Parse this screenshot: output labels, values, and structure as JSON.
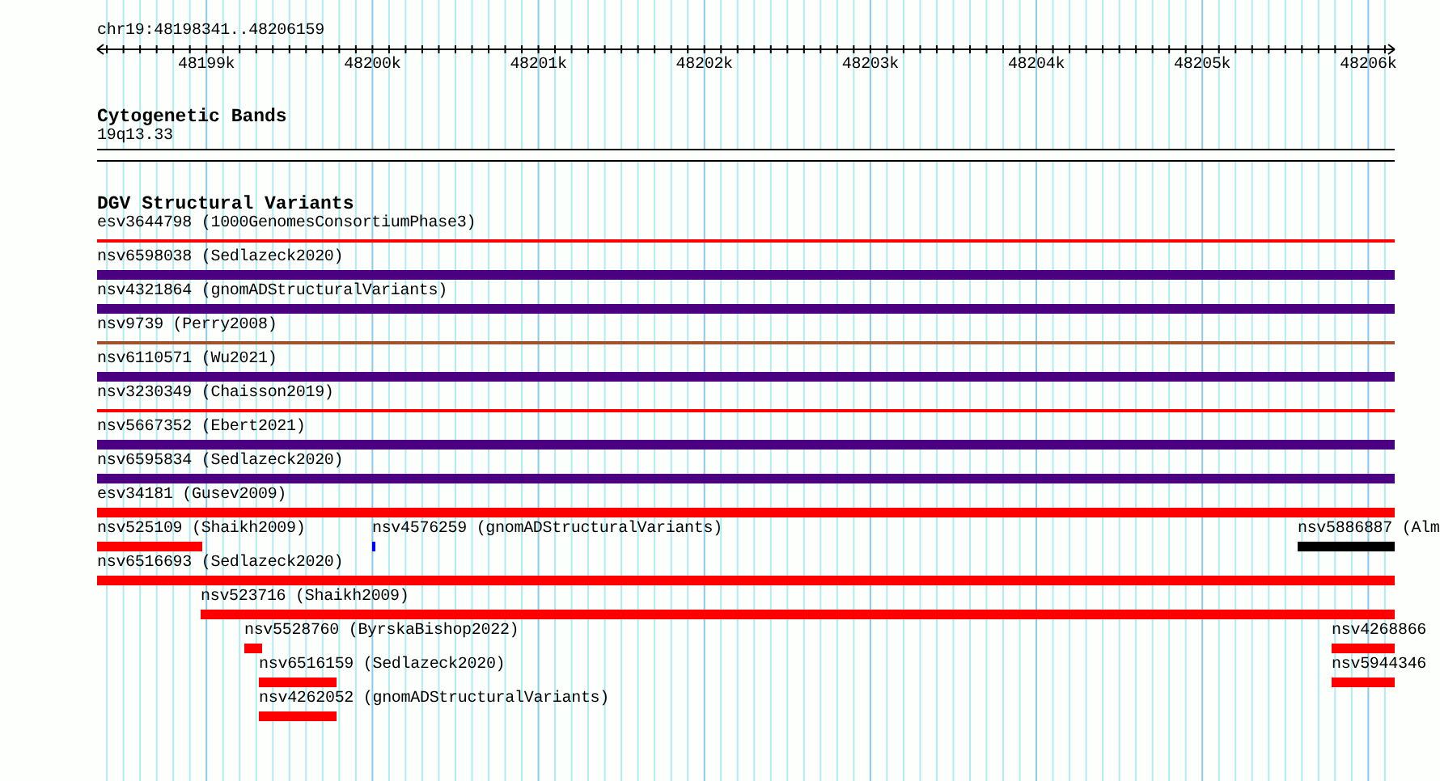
{
  "ruler": {
    "location": "chr19:48198341..48206159",
    "ticks": [
      "48199k",
      "48200k",
      "48201k",
      "48202k",
      "48203k",
      "48204k",
      "48205k",
      "48206k"
    ]
  },
  "cytogenetic_bands": {
    "title": "Cytogenetic Bands",
    "band": "19q13.33"
  },
  "dgv_structural_variants": {
    "title": "DGV Structural Variants",
    "rows": [
      [
        {
          "name": "esv3644798 (1000GenomesConsortiumPhase3)",
          "color": "#ff0000",
          "kind": "line"
        }
      ],
      [
        {
          "name": "nsv6598038 (Sedlazeck2020)",
          "color": "#4b0082",
          "kind": "bar"
        }
      ],
      [
        {
          "name": "nsv4321864 (gnomADStructuralVariants)",
          "color": "#4b0082",
          "kind": "bar"
        }
      ],
      [
        {
          "name": "nsv9739 (Perry2008)",
          "color": "#a0522d",
          "kind": "line"
        }
      ],
      [
        {
          "name": "nsv6110571 (Wu2021)",
          "color": "#4b0082",
          "kind": "bar"
        }
      ],
      [
        {
          "name": "nsv3230349 (Chaisson2019)",
          "color": "#ff0000",
          "kind": "line"
        }
      ],
      [
        {
          "name": "nsv5667352 (Ebert2021)",
          "color": "#4b0082",
          "kind": "bar"
        }
      ],
      [
        {
          "name": "nsv6595834 (Sedlazeck2020)",
          "color": "#4b0082",
          "kind": "bar"
        }
      ],
      [
        {
          "name": "esv34181 (Gusev2009)",
          "color": "#ff0000",
          "kind": "bar"
        }
      ],
      [
        {
          "name": "nsv525109 (Shaikh2009)",
          "color": "#ff0000",
          "kind": "bar"
        },
        {
          "name": "nsv4576259 (gnomADStructuralVariants)",
          "color": "#0000ff",
          "kind": "bar"
        },
        {
          "name": "nsv5886887 (Alm",
          "color": "#000000",
          "kind": "bar"
        }
      ],
      [
        {
          "name": "nsv6516693 (Sedlazeck2020)",
          "color": "#ff0000",
          "kind": "bar"
        }
      ],
      [
        {
          "name": "nsv523716 (Shaikh2009)",
          "color": "#ff0000",
          "kind": "bar"
        }
      ],
      [
        {
          "name": "nsv5528760 (ByrskaBishop2022)",
          "color": "#ff0000",
          "kind": "bar"
        },
        {
          "name": "nsv4268866",
          "color": "#ff0000",
          "kind": "bar"
        }
      ],
      [
        {
          "name": "nsv6516159 (Sedlazeck2020)",
          "color": "#ff0000",
          "kind": "bar"
        },
        {
          "name": "nsv5944346",
          "color": "#ff0000",
          "kind": "bar"
        }
      ],
      [
        {
          "name": "nsv4262052 (gnomADStructuralVariants)",
          "color": "#ff0000",
          "kind": "bar"
        }
      ]
    ]
  }
}
